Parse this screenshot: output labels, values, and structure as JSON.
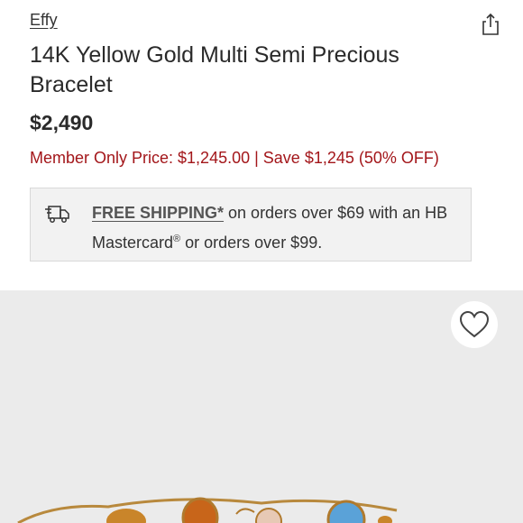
{
  "product": {
    "brand": "Effy",
    "title": "14K Yellow Gold Multi Semi Precious Bracelet",
    "price": "$2,490",
    "member_price": "Member Only Price: $1,245.00 | Save $1,245 (50% OFF)"
  },
  "shipping": {
    "link_label": "FREE SHIPPING*",
    "text_part1": " on orders over $69 with an HB Mastercard",
    "registered_mark": "®",
    "text_part2": " or orders over $99."
  },
  "icons": {
    "share": "share-icon",
    "truck": "delivery-truck-icon",
    "wishlist": "heart-icon"
  },
  "colors": {
    "member_price": "#a3161a",
    "image_background": "#ebebeb"
  }
}
